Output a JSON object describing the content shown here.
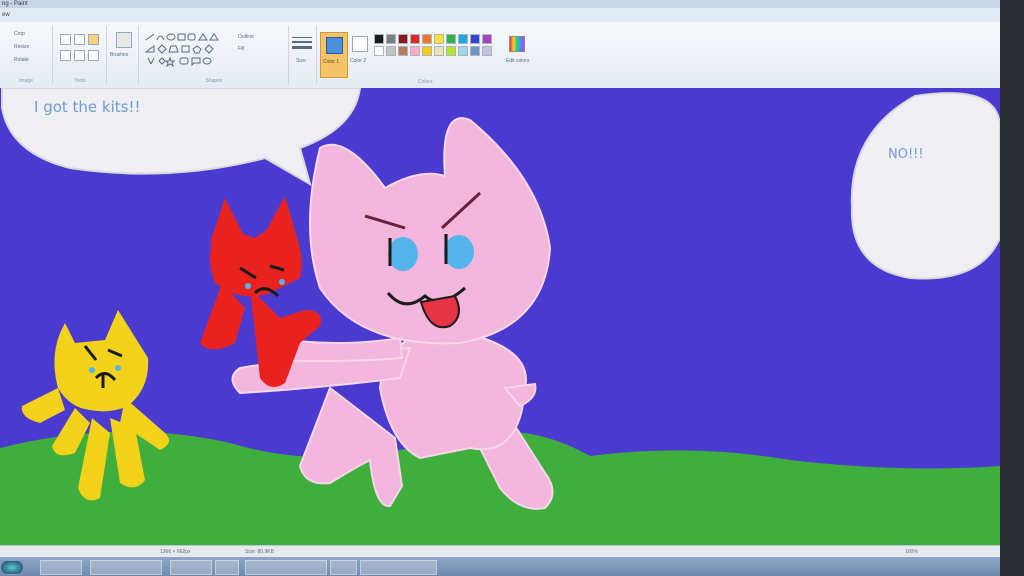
{
  "window": {
    "title": "ng - Paint",
    "menu_label": "ew"
  },
  "ribbon": {
    "image_group": {
      "crop": "Crop",
      "resize": "Resize",
      "rotate": "Rotate",
      "label": "Image"
    },
    "tools_group": {
      "label": "Tools"
    },
    "brushes_label": "Brushes",
    "shapes_group": {
      "outline": "Outline",
      "fill": "Fill",
      "label": "Shapes"
    },
    "size_label": "Size",
    "color1_label": "Color 1",
    "color2_label": "Color 2",
    "edit_colors_label": "Edit colors",
    "colors_group_label": "Colors",
    "palette": [
      "#1a1a1a",
      "#7f7f7f",
      "#8b1a1a",
      "#e02828",
      "#f07c2a",
      "#f5e23a",
      "#2fb34a",
      "#22a8e0",
      "#3344cc",
      "#a046c0",
      "#ffffff",
      "#c3c3c3",
      "#b97a57",
      "#ffaec9",
      "#ffc90e",
      "#efe4b0",
      "#b5e61d",
      "#99d9ea",
      "#7092be",
      "#c8bfe7"
    ]
  },
  "drawing": {
    "speech_left": "I got the kits!!",
    "speech_right": "NO!!!"
  },
  "status": {
    "dimensions": "1366 × 662px",
    "size": "Size: 80.9KB",
    "zoom": "100%"
  },
  "colors": {
    "sky": "#4a3ad0",
    "grass": "#3fae3c",
    "pink_cat": "#f3b6dc",
    "red_kit": "#e8221f",
    "yellow_kit": "#f2d21a",
    "bubble": "#f0f0f4"
  }
}
